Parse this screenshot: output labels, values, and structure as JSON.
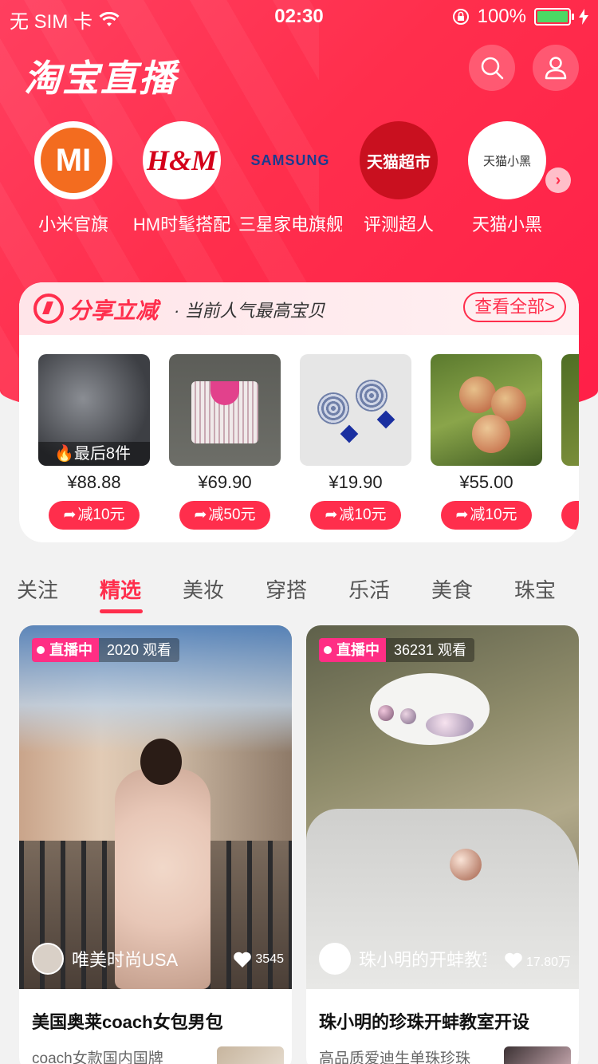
{
  "status_bar": {
    "carrier": "无 SIM 卡",
    "time": "02:30",
    "battery": "100%"
  },
  "header": {
    "title": "淘宝直播"
  },
  "stores": [
    {
      "name": "小米官旗",
      "logo": "MI"
    },
    {
      "name": "HM时髦搭配",
      "logo": "H&M"
    },
    {
      "name": "三星家电旗舰",
      "logo": "SAMSUNG"
    },
    {
      "name": "评测超人",
      "logo": "天猫超市"
    },
    {
      "name": "天猫小黑",
      "logo": "天猫小黑"
    }
  ],
  "share_section": {
    "title": "分享立减",
    "subtitle": "· 当前人气最高宝贝",
    "view_all": "查看全部>",
    "products": [
      {
        "price": "¥88.88",
        "cut": "减10元",
        "badge": "最后8件"
      },
      {
        "price": "¥69.90",
        "cut": "减50元",
        "badge": ""
      },
      {
        "price": "¥19.90",
        "cut": "减10元",
        "badge": ""
      },
      {
        "price": "¥55.00",
        "cut": "减10元",
        "badge": ""
      }
    ]
  },
  "tabs": [
    "关注",
    "精选",
    "美妆",
    "穿搭",
    "乐活",
    "美食",
    "珠宝"
  ],
  "active_tab": "精选",
  "feed": [
    {
      "live_label": "直播中",
      "viewers": "2020 观看",
      "anchor": "唯美时尚USA",
      "likes": "3545",
      "title": "美国奥莱coach女包男包",
      "desc": "coach女款国内国牌"
    },
    {
      "live_label": "直播中",
      "viewers": "36231 观看",
      "anchor": "珠小明的开蚌教室",
      "likes": "17.80万",
      "title": "珠小明的珍珠开蚌教室开设",
      "desc": "高品质爱迪生单珠珍珠"
    }
  ],
  "colors": {
    "brand_red": "#ff2e4c",
    "live_pink": "#ff2e84"
  }
}
